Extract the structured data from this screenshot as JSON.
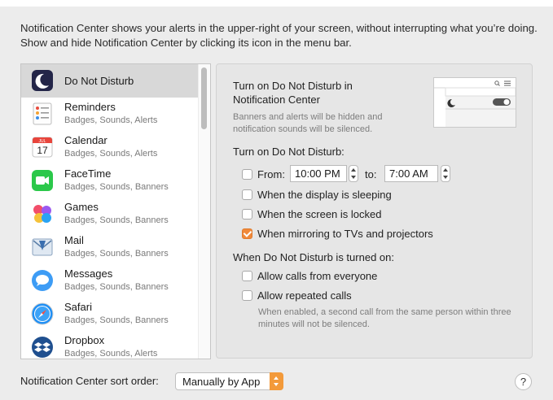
{
  "intro_text": "Notification Center shows your alerts in the upper-right of your screen, without interrupting what you’re doing. Show and hide Notification Center by clicking its icon in the menu bar.",
  "apps": [
    {
      "name": "Do Not Disturb",
      "subtitle": "",
      "icon": "moon-icon"
    },
    {
      "name": "Reminders",
      "subtitle": "Badges, Sounds, Alerts",
      "icon": "reminders-icon"
    },
    {
      "name": "Calendar",
      "subtitle": "Badges, Sounds, Alerts",
      "icon": "calendar-icon",
      "icon_month": "JUL",
      "icon_day": "17"
    },
    {
      "name": "FaceTime",
      "subtitle": "Badges, Sounds, Banners",
      "icon": "facetime-icon"
    },
    {
      "name": "Games",
      "subtitle": "Badges, Sounds, Banners",
      "icon": "games-icon"
    },
    {
      "name": "Mail",
      "subtitle": "Badges, Sounds, Banners",
      "icon": "mail-icon"
    },
    {
      "name": "Messages",
      "subtitle": "Badges, Sounds, Banners",
      "icon": "messages-icon"
    },
    {
      "name": "Safari",
      "subtitle": "Badges, Sounds, Banners",
      "icon": "safari-icon"
    },
    {
      "name": "Dropbox",
      "subtitle": "Badges, Sounds, Alerts",
      "icon": "dropbox-icon"
    }
  ],
  "panel": {
    "title": "Turn on Do Not Disturb in Notification Center",
    "note": "Banners and alerts will be hidden and notification sounds will be silenced.",
    "turn_on_label": "Turn on Do Not Disturb:",
    "from_label": "From:",
    "from_time": "10:00 PM",
    "to_label": "to:",
    "to_time": "7:00 AM",
    "options": [
      {
        "label": "When the display is sleeping",
        "checked": false
      },
      {
        "label": "When the screen is locked",
        "checked": false
      },
      {
        "label": "When mirroring to TVs and projectors",
        "checked": true
      }
    ],
    "when_on_label": "When Do Not Disturb is turned on:",
    "calls": [
      {
        "label": "Allow calls from everyone",
        "checked": false
      },
      {
        "label": "Allow repeated calls",
        "checked": false
      }
    ],
    "calls_note": "When enabled, a second call from the same person within three minutes will not be silenced."
  },
  "footer": {
    "sort_label": "Notification Center sort order:",
    "sort_value": "Manually by App",
    "help": "?"
  },
  "colors": {
    "accent": "#f0893a",
    "selected_row": "#d8d8d8"
  }
}
